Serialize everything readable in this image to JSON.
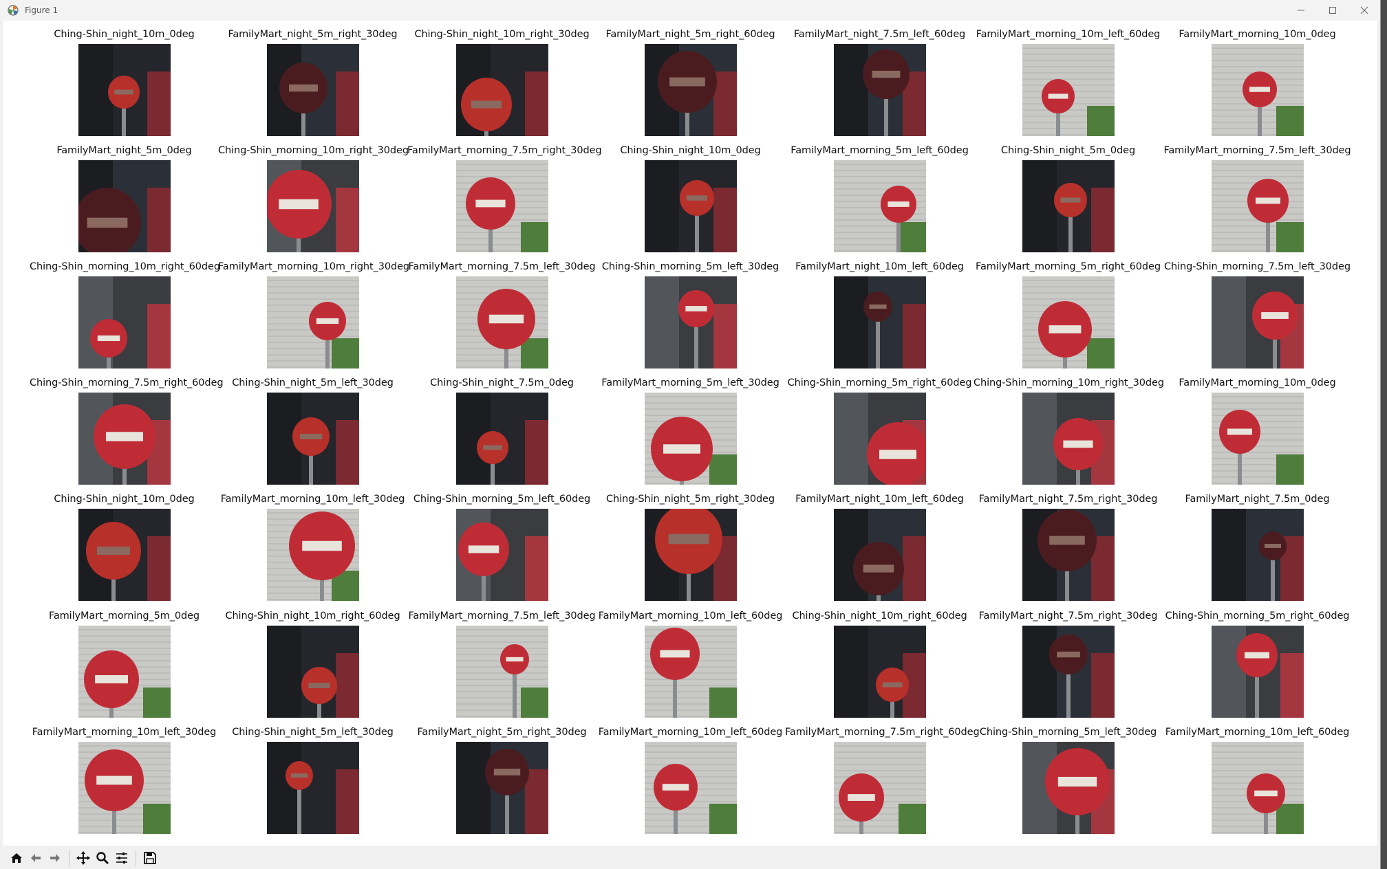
{
  "window": {
    "title": "Figure 1"
  },
  "icons": {
    "app": "matplotlib-icon",
    "minimize": "minimize-icon",
    "maximize": "maximize-icon",
    "close": "close-icon",
    "toolbar": [
      "home-icon",
      "back-arrow-icon",
      "forward-arrow-icon",
      "pan-icon",
      "zoom-icon",
      "configure-subplots-icon",
      "save-icon"
    ]
  },
  "grid": {
    "rows": [
      [
        "Ching-Shin_night_10m_0deg",
        "FamilyMart_night_5m_right_30deg",
        "Ching-Shin_night_10m_right_30deg",
        "FamilyMart_night_5m_right_60deg",
        "FamilyMart_night_7.5m_left_60deg",
        "FamilyMart_morning_10m_left_60deg",
        "FamilyMart_morning_10m_0deg"
      ],
      [
        "FamilyMart_night_5m_0deg",
        "Ching-Shin_morning_10m_right_30deg",
        "FamilyMart_morning_7.5m_right_30deg",
        "Ching-Shin_night_10m_0deg",
        "FamilyMart_morning_5m_left_60deg",
        "Ching-Shin_night_5m_0deg",
        "FamilyMart_morning_7.5m_left_30deg"
      ],
      [
        "Ching-Shin_morning_10m_right_60deg",
        "FamilyMart_morning_10m_right_30deg",
        "FamilyMart_morning_7.5m_left_30deg",
        "Ching-Shin_morning_5m_left_30deg",
        "FamilyMart_night_10m_left_60deg",
        "FamilyMart_morning_5m_right_60deg",
        "Ching-Shin_morning_7.5m_left_30deg"
      ],
      [
        "Ching-Shin_morning_7.5m_right_60deg",
        "Ching-Shin_night_5m_left_30deg",
        "Ching-Shin_night_7.5m_0deg",
        "FamilyMart_morning_5m_left_30deg",
        "Ching-Shin_morning_5m_right_60deg",
        "Ching-Shin_morning_10m_right_30deg",
        "FamilyMart_morning_10m_0deg"
      ],
      [
        "Ching-Shin_night_10m_0deg",
        "FamilyMart_morning_10m_left_30deg",
        "Ching-Shin_morning_5m_left_60deg",
        "Ching-Shin_night_5m_right_30deg",
        "FamilyMart_night_10m_left_60deg",
        "FamilyMart_night_7.5m_right_30deg",
        "FamilyMart_night_7.5m_0deg"
      ],
      [
        "FamilyMart_morning_5m_0deg",
        "Ching-Shin_night_10m_right_60deg",
        "FamilyMart_morning_7.5m_left_30deg",
        "FamilyMart_morning_10m_left_60deg",
        "Ching-Shin_night_10m_right_60deg",
        "FamilyMart_night_7.5m_right_30deg",
        "Ching-Shin_morning_5m_right_60deg"
      ],
      [
        "FamilyMart_morning_10m_left_30deg",
        "Ching-Shin_night_5m_left_30deg",
        "FamilyMart_night_5m_right_30deg",
        "FamilyMart_morning_10m_left_60deg",
        "FamilyMart_morning_7.5m_right_60deg",
        "Ching-Shin_morning_5m_left_30deg",
        "FamilyMart_morning_10m_left_60deg"
      ]
    ]
  },
  "colors": {
    "sign_red_day": "#c9303a",
    "sign_red_night": "#6a1f24",
    "sign_dark_night": "#3a1a1a",
    "bar_white": "#e8e4dc",
    "wall_day": "#c8c8c8",
    "bg_night": "#2a2d33"
  }
}
